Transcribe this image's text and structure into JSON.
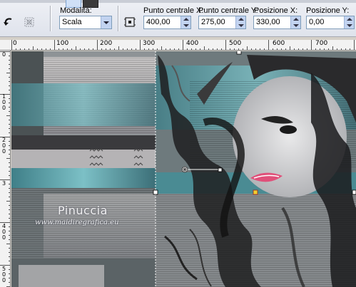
{
  "toolbar": {
    "mode_label": "Modalità:",
    "mode_value": "Scala",
    "center_x_label": "Punto centrale X:",
    "center_x_value": "400,00",
    "center_y_label": "Punto centrale Y:",
    "center_y_value": "275,00",
    "position_x_label": "Posizione X:",
    "position_x_value": "330,00",
    "position_y_label": "Posizione Y:",
    "position_y_value": "0,00",
    "icons": [
      "rotate-arrow-icon",
      "reset-transform-icon",
      "select-tool-icon",
      "center-point-icon"
    ]
  },
  "rulers": {
    "horizontal": [
      "0",
      "100",
      "200",
      "300",
      "400",
      "500",
      "600",
      "700"
    ],
    "vertical": [
      "0",
      "1 0 0",
      "2 0 0",
      "3",
      "4 0 0",
      "5 0 0"
    ]
  },
  "canvas": {
    "watermark_name": "Pinuccia",
    "watermark_url": "www.maidiregrafica.eu",
    "colors": {
      "teal": "#5b9aa3",
      "dark": "#1c1c1e",
      "gray": "#9a9a9c",
      "lips": "#e0507a"
    }
  }
}
